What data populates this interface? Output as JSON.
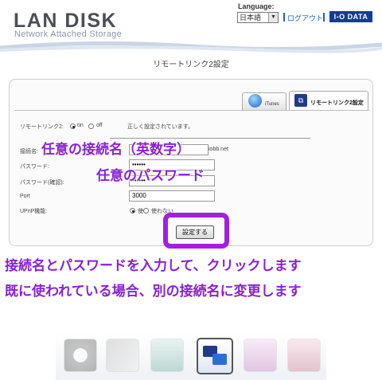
{
  "header": {
    "logo_title": "LAN DISK",
    "logo_subtitle": "Network Attached Storage",
    "language_label": "Language:",
    "language_value": "日本語",
    "logout": "ログアウト",
    "brand": "I-O DATA"
  },
  "page": {
    "title": "リモートリンク2設定"
  },
  "tabs": [
    {
      "label": "iTunes",
      "icon": "itunes-icon"
    },
    {
      "label": "リモートリンク2設定",
      "icon": "remote-link-icon"
    }
  ],
  "form": {
    "remote_label": "リモートリンク2:",
    "remote_on": "on",
    "remote_off": "off",
    "status_text": "正しく設定されています。",
    "conn_name_label": "接続名:",
    "domain_suffix": "iobb.net",
    "password_label": "パスワード:",
    "password_value": "••••••",
    "password_confirm_label": "パスワード(確認):",
    "password_confirm_value": "••••••",
    "port_label": "Port",
    "port_value": "3000",
    "upnp_label": "UPnP機能:",
    "upnp_use": "使う",
    "upnp_nouse": "使わない",
    "submit": "設定する"
  },
  "overlays": {
    "conn_name_note": "任意の接続名（英数字）",
    "password_note": "任意のパスワード",
    "instruction_1": "接続名とパスワードを入力して、クリックします",
    "instruction_2": "既に使われている場合、別の接続名に変更します"
  },
  "dock": [
    "power-icon",
    "tools-icon",
    "users-icon",
    "remote-link-icon",
    "share-icon",
    "media-icon"
  ],
  "colors": {
    "accent": "#a21fe0",
    "overlay_text": "#8a1fd6",
    "link": "#1565c0",
    "brand_bg": "#123d94"
  }
}
